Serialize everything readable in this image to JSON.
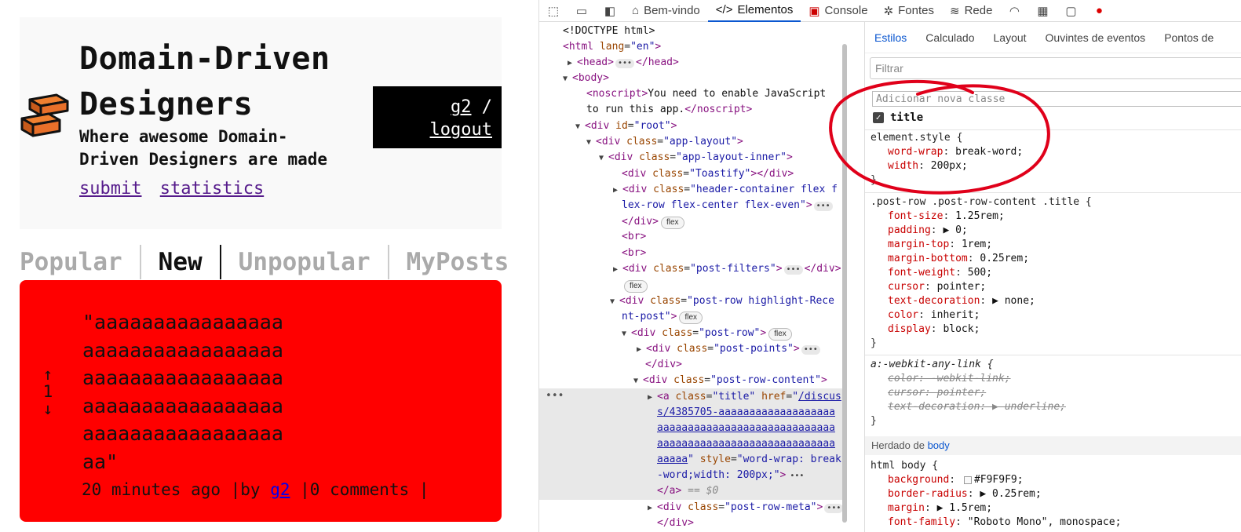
{
  "app": {
    "site_title": "Domain-Driven Designers",
    "site_subtitle": "Where awesome Domain-Driven Designers are made",
    "nav": {
      "submit": "submit",
      "statistics": "statistics"
    },
    "user": {
      "name": "g2",
      "separator": "/",
      "logout": "logout"
    },
    "filters": [
      "Popular",
      "New",
      "Unpopular",
      "MyPosts"
    ],
    "active_filter": "New",
    "post": {
      "up_arrow": "↑",
      "points": "1",
      "down_arrow": "↓",
      "title": "\"aaaaaaaaaaaaaaaaaaaaaaaaaaaaaaaaaaaaaaaaaaaaaaaaaaaaaaaaaaaaaaaaaaaaaaaaaaaaaaaaaaaaaa\"",
      "meta_time": "20 minutes ago |by ",
      "meta_author": "g2",
      "meta_comments": " |0 comments |",
      "background": "#ff0000"
    }
  },
  "devtools": {
    "toolbar": {
      "tabs": [
        {
          "label": "Bem-vindo",
          "icon": "home-icon"
        },
        {
          "label": "Elementos",
          "icon": "code-icon"
        },
        {
          "label": "Console",
          "icon": "console-icon"
        },
        {
          "label": "Fontes",
          "icon": "bug-icon"
        },
        {
          "label": "Rede",
          "icon": "wifi-icon"
        }
      ],
      "active_tab": "Elementos"
    },
    "dom": {
      "doctype": "<!DOCTYPE html>",
      "html_open": "html",
      "html_lang_attr": "lang",
      "html_lang_val": "\"en\"",
      "head": "head",
      "body": "body",
      "noscript_tag": "noscript",
      "noscript_text_1": "You need to enable JavaScript",
      "noscript_text_2": "to run this app.",
      "root_id": "\"root\"",
      "app_layout": "\"app-layout\"",
      "app_layout_inner": "\"app-layout-inner\"",
      "toastify": "\"Toastify\"",
      "header_container_1": "\"header-container flex f",
      "header_container_2": "lex-row flex-center flex-even\"",
      "post_filters": "\"post-filters\"",
      "post_row_highlight_1": "\"post-row highlight-Rece",
      "post_row_highlight_2": "nt-post\"",
      "post_row": "\"post-row\"",
      "post_points": "\"post-points\"",
      "post_row_content": "\"post-row-content\"",
      "a_class": "\"title\"",
      "href_1": "/discus",
      "href_2": "s/4385705-aaaaaaaaaaaaaaaaaaa",
      "href_3": "aaaaaaaaaaaaaaaaaaaaaaaaaaaaa",
      "href_4": "aaaaaaaaaaaaaaaaaaaaaaaaaaaaa",
      "href_5": "aaaaa",
      "style_attr_1": "\"word-wrap: break",
      "style_attr_2": "-word;width: 200px;\"",
      "dollar0": "== $0",
      "post_row_meta": "\"post-row-meta\"",
      "badge_flex": "flex"
    },
    "styles": {
      "tabs": [
        "Estilos",
        "Calculado",
        "Layout",
        "Ouvintes de eventos",
        "Pontos de"
      ],
      "active_tab": "Estilos",
      "filter_placeholder": "Filtrar",
      "class_placeholder": "Adicionar nova classe",
      "class_checkbox_label": "title",
      "element_style_selector": "element.style {",
      "element_style": [
        {
          "prop": "word-wrap",
          "val": "break-word;"
        },
        {
          "prop": "width",
          "val": "200px;"
        }
      ],
      "rule2_selector": ".post-row .post-row-content .title {",
      "rule2": [
        {
          "prop": "font-size",
          "val": "1.25rem;"
        },
        {
          "prop": "padding",
          "val": "▶ 0;"
        },
        {
          "prop": "margin-top",
          "val": "1rem;"
        },
        {
          "prop": "margin-bottom",
          "val": "0.25rem;"
        },
        {
          "prop": "font-weight",
          "val": "500;"
        },
        {
          "prop": "cursor",
          "val": "pointer;"
        },
        {
          "prop": "text-decoration",
          "val": "▶ none;"
        },
        {
          "prop": "color",
          "val": "inherit;"
        },
        {
          "prop": "display",
          "val": "block;"
        }
      ],
      "rule3_selector": "a:-webkit-any-link {",
      "rule3": [
        "color: -webkit-link;",
        "cursor: pointer;",
        "text-decoration: ▶ underline;"
      ],
      "inherited_label": "Herdado de ",
      "inherited_from": "body",
      "rule4_selector": "html body {",
      "rule4": [
        {
          "prop": "background",
          "val": "#F9F9F9;"
        },
        {
          "prop": "border-radius",
          "val": "▶ 0.25rem;"
        },
        {
          "prop": "margin",
          "val": "▶ 1.5rem;"
        },
        {
          "prop": "font-family",
          "val": "\"Roboto Mono\", monospace;"
        }
      ],
      "close_brace": "}"
    },
    "annotation_color": "#e0001a"
  }
}
